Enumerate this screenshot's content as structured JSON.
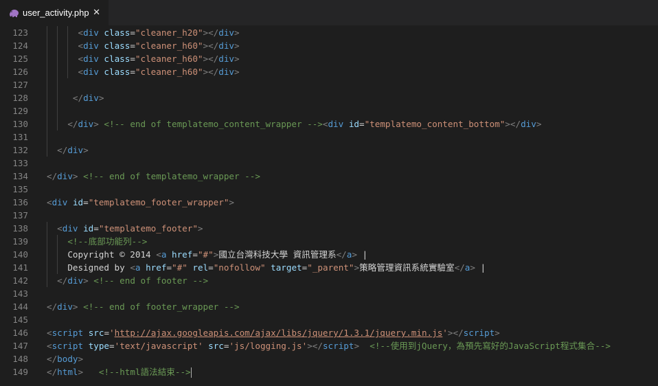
{
  "tab": {
    "filename": "user_activity.php",
    "icon": "php-elephant-icon",
    "close_glyph": "✕"
  },
  "colors": {
    "background": "#1e1e1e",
    "tag": "#569cd6",
    "attribute": "#9cdcfe",
    "string": "#ce9178",
    "comment": "#6a9955",
    "line_number": "#858585"
  },
  "lines": [
    {
      "n": "123",
      "indent": 6,
      "tokens": [
        [
          "p",
          "<"
        ],
        [
          "t",
          "div"
        ],
        [
          "tx",
          " "
        ],
        [
          "a",
          "class"
        ],
        [
          "tx",
          "="
        ],
        [
          "s",
          "\"cleaner_h20\""
        ],
        [
          "p",
          ">"
        ],
        [
          "p",
          "</"
        ],
        [
          "t",
          "div"
        ],
        [
          "p",
          ">"
        ]
      ]
    },
    {
      "n": "124",
      "indent": 6,
      "tokens": [
        [
          "p",
          "<"
        ],
        [
          "t",
          "div"
        ],
        [
          "tx",
          " "
        ],
        [
          "a",
          "class"
        ],
        [
          "tx",
          "="
        ],
        [
          "s",
          "\"cleaner_h60\""
        ],
        [
          "p",
          ">"
        ],
        [
          "p",
          "</"
        ],
        [
          "t",
          "div"
        ],
        [
          "p",
          ">"
        ]
      ]
    },
    {
      "n": "125",
      "indent": 6,
      "tokens": [
        [
          "p",
          "<"
        ],
        [
          "t",
          "div"
        ],
        [
          "tx",
          " "
        ],
        [
          "a",
          "class"
        ],
        [
          "tx",
          "="
        ],
        [
          "s",
          "\"cleaner_h60\""
        ],
        [
          "p",
          ">"
        ],
        [
          "p",
          "</"
        ],
        [
          "t",
          "div"
        ],
        [
          "p",
          ">"
        ]
      ]
    },
    {
      "n": "126",
      "indent": 6,
      "tokens": [
        [
          "p",
          "<"
        ],
        [
          "t",
          "div"
        ],
        [
          "tx",
          " "
        ],
        [
          "a",
          "class"
        ],
        [
          "tx",
          "="
        ],
        [
          "s",
          "\"cleaner_h60\""
        ],
        [
          "p",
          ">"
        ],
        [
          "p",
          "</"
        ],
        [
          "t",
          "div"
        ],
        [
          "p",
          ">"
        ]
      ]
    },
    {
      "n": "127",
      "indent": 0,
      "tokens": []
    },
    {
      "n": "128",
      "indent": 5,
      "tokens": [
        [
          "p",
          "</"
        ],
        [
          "t",
          "div"
        ],
        [
          "p",
          ">"
        ]
      ]
    },
    {
      "n": "129",
      "indent": 0,
      "tokens": []
    },
    {
      "n": "130",
      "indent": 4,
      "tokens": [
        [
          "p",
          "</"
        ],
        [
          "t",
          "div"
        ],
        [
          "p",
          ">"
        ],
        [
          "tx",
          " "
        ],
        [
          "c",
          "<!-- end of templatemo_content_wrapper -->"
        ],
        [
          "p",
          "<"
        ],
        [
          "t",
          "div"
        ],
        [
          "tx",
          " "
        ],
        [
          "a",
          "id"
        ],
        [
          "tx",
          "="
        ],
        [
          "s",
          "\"templatemo_content_bottom\""
        ],
        [
          "p",
          ">"
        ],
        [
          "p",
          "</"
        ],
        [
          "t",
          "div"
        ],
        [
          "p",
          ">"
        ]
      ]
    },
    {
      "n": "131",
      "indent": 0,
      "tokens": []
    },
    {
      "n": "132",
      "indent": 2,
      "tokens": [
        [
          "p",
          "</"
        ],
        [
          "t",
          "div"
        ],
        [
          "p",
          ">"
        ]
      ]
    },
    {
      "n": "133",
      "indent": 0,
      "tokens": []
    },
    {
      "n": "134",
      "indent": 0,
      "tokens": [
        [
          "p",
          "</"
        ],
        [
          "t",
          "div"
        ],
        [
          "p",
          ">"
        ],
        [
          "tx",
          " "
        ],
        [
          "c",
          "<!-- end of templatemo_wrapper -->"
        ]
      ]
    },
    {
      "n": "135",
      "indent": 0,
      "tokens": []
    },
    {
      "n": "136",
      "indent": 0,
      "tokens": [
        [
          "p",
          "<"
        ],
        [
          "t",
          "div"
        ],
        [
          "tx",
          " "
        ],
        [
          "a",
          "id"
        ],
        [
          "tx",
          "="
        ],
        [
          "s",
          "\"templatemo_footer_wrapper\""
        ],
        [
          "p",
          ">"
        ]
      ]
    },
    {
      "n": "137",
      "indent": 0,
      "tokens": []
    },
    {
      "n": "138",
      "indent": 2,
      "tokens": [
        [
          "p",
          "<"
        ],
        [
          "t",
          "div"
        ],
        [
          "tx",
          " "
        ],
        [
          "a",
          "id"
        ],
        [
          "tx",
          "="
        ],
        [
          "s",
          "\"templatemo_footer\""
        ],
        [
          "p",
          ">"
        ]
      ]
    },
    {
      "n": "139",
      "indent": 4,
      "tokens": [
        [
          "c",
          "<!--底部功能列-->"
        ]
      ]
    },
    {
      "n": "140",
      "indent": 4,
      "tokens": [
        [
          "tx",
          "Copyright © 2014 "
        ],
        [
          "p",
          "<"
        ],
        [
          "t",
          "a"
        ],
        [
          "tx",
          " "
        ],
        [
          "a",
          "href"
        ],
        [
          "tx",
          "="
        ],
        [
          "s",
          "\"#\""
        ],
        [
          "p",
          ">"
        ],
        [
          "tx",
          "國立台灣科技大學 資訊管理系"
        ],
        [
          "p",
          "</"
        ],
        [
          "t",
          "a"
        ],
        [
          "p",
          ">"
        ],
        [
          "tx",
          " |"
        ]
      ]
    },
    {
      "n": "141",
      "indent": 4,
      "tokens": [
        [
          "tx",
          "Designed by "
        ],
        [
          "p",
          "<"
        ],
        [
          "t",
          "a"
        ],
        [
          "tx",
          " "
        ],
        [
          "a",
          "href"
        ],
        [
          "tx",
          "="
        ],
        [
          "s",
          "\"#\""
        ],
        [
          "tx",
          " "
        ],
        [
          "a",
          "rel"
        ],
        [
          "tx",
          "="
        ],
        [
          "s",
          "\"nofollow\""
        ],
        [
          "tx",
          " "
        ],
        [
          "a",
          "target"
        ],
        [
          "tx",
          "="
        ],
        [
          "s",
          "\"_parent\""
        ],
        [
          "p",
          ">"
        ],
        [
          "tx",
          "策略管理資訊系統實驗室"
        ],
        [
          "p",
          "</"
        ],
        [
          "t",
          "a"
        ],
        [
          "p",
          ">"
        ],
        [
          "tx",
          " |"
        ]
      ]
    },
    {
      "n": "142",
      "indent": 2,
      "tokens": [
        [
          "p",
          "</"
        ],
        [
          "t",
          "div"
        ],
        [
          "p",
          ">"
        ],
        [
          "tx",
          " "
        ],
        [
          "c",
          "<!-- end of footer -->"
        ]
      ]
    },
    {
      "n": "143",
      "indent": 0,
      "tokens": []
    },
    {
      "n": "144",
      "indent": 0,
      "tokens": [
        [
          "p",
          "</"
        ],
        [
          "t",
          "div"
        ],
        [
          "p",
          ">"
        ],
        [
          "tx",
          " "
        ],
        [
          "c",
          "<!-- end of footer_wrapper -->"
        ]
      ]
    },
    {
      "n": "145",
      "indent": 0,
      "tokens": []
    },
    {
      "n": "146",
      "indent": 0,
      "tokens": [
        [
          "p",
          "<"
        ],
        [
          "t",
          "script"
        ],
        [
          "tx",
          " "
        ],
        [
          "a",
          "src"
        ],
        [
          "tx",
          "="
        ],
        [
          "s",
          "'"
        ],
        [
          "su",
          "http://ajax.googleapis.com/ajax/libs/jquery/1.3.1/jquery.min.js"
        ],
        [
          "s",
          "'"
        ],
        [
          "p",
          ">"
        ],
        [
          "p",
          "</"
        ],
        [
          "t",
          "script"
        ],
        [
          "p",
          ">"
        ]
      ]
    },
    {
      "n": "147",
      "indent": 0,
      "tokens": [
        [
          "p",
          "<"
        ],
        [
          "t",
          "script"
        ],
        [
          "tx",
          " "
        ],
        [
          "a",
          "type"
        ],
        [
          "tx",
          "="
        ],
        [
          "s",
          "'text/javascript'"
        ],
        [
          "tx",
          " "
        ],
        [
          "a",
          "src"
        ],
        [
          "tx",
          "="
        ],
        [
          "s",
          "'js/logging.js'"
        ],
        [
          "p",
          ">"
        ],
        [
          "p",
          "</"
        ],
        [
          "t",
          "script"
        ],
        [
          "p",
          ">"
        ],
        [
          "tx",
          "  "
        ],
        [
          "c",
          "<!--使用到jQuery，為預先寫好的JavaScript程式集合-->"
        ]
      ]
    },
    {
      "n": "148",
      "indent": 0,
      "tokens": [
        [
          "p",
          "</"
        ],
        [
          "t",
          "body"
        ],
        [
          "p",
          ">"
        ]
      ]
    },
    {
      "n": "149",
      "indent": 0,
      "tokens": [
        [
          "p",
          "</"
        ],
        [
          "t",
          "html"
        ],
        [
          "p",
          ">"
        ],
        [
          "tx",
          "   "
        ],
        [
          "c",
          "<!--html語法結束-->"
        ],
        [
          "cursor",
          ""
        ]
      ]
    }
  ]
}
